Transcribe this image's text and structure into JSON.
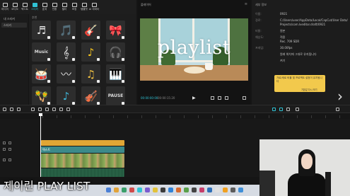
{
  "toolbar": {
    "tools": [
      {
        "label": "미디어",
        "active": false
      },
      {
        "label": "오디오",
        "active": false
      },
      {
        "label": "텍스트",
        "active": false
      },
      {
        "label": "스티커",
        "active": true
      },
      {
        "label": "효과",
        "active": false
      },
      {
        "label": "전환",
        "active": false
      },
      {
        "label": "필터",
        "active": false
      },
      {
        "label": "조정",
        "active": false
      },
      {
        "label": "템플릿",
        "active": false
      },
      {
        "label": "AI 아바타",
        "active": false
      }
    ]
  },
  "sidebar": {
    "items": [
      "내 스티커",
      "스티커",
      "",
      "",
      "",
      ""
    ]
  },
  "media": {
    "header": "추천",
    "stickers": [
      {
        "icon": "♬",
        "color": "#e8e8e8"
      },
      {
        "icon": "🎵",
        "color": "#e8e8e8"
      },
      {
        "icon": "🎸",
        "color": "#e59a2c"
      },
      {
        "icon": "🎀",
        "color": "#d6403a"
      },
      {
        "icon": "Music",
        "color": "#d9d9d9"
      },
      {
        "icon": "𝄞",
        "color": "#e8e8e8"
      },
      {
        "icon": "♪",
        "color": "#f5c31e"
      },
      {
        "icon": "🎧",
        "color": "#e8e8e8"
      },
      {
        "icon": "🥁",
        "color": "#d64f7a"
      },
      {
        "icon": "〰",
        "color": "#e8e8e8"
      },
      {
        "icon": "♫",
        "color": "#f0c040"
      },
      {
        "icon": "🎹",
        "color": "#e84e8a"
      },
      {
        "icon": "🪇",
        "color": "#e08a3a"
      },
      {
        "icon": "♪",
        "color": "#3fb6d8"
      },
      {
        "icon": "🎻",
        "color": "#d4a060"
      },
      {
        "icon": "PAUSE",
        "color": "#dcdcdc"
      }
    ]
  },
  "player": {
    "header": "플레이어",
    "video_title": "playlist",
    "timecode_current": "00:00:00:00",
    "timecode_total": "00:00:15:20"
  },
  "details": {
    "header": "세부 정보",
    "rows": [
      {
        "key": "이름:",
        "value": "0921"
      },
      {
        "key": "경로:",
        "value": "C:/Users/user/AppData/Local/CapCut/User Data/"
      },
      {
        "key": "",
        "value": "Projects/com.lveditor.draft/0921"
      },
      {
        "key": "비율:",
        "value": "원본"
      },
      {
        "key": "해상도:",
        "value": "적용"
      },
      {
        "key": "",
        "value": "Rec. 709 SDR"
      },
      {
        "key": "프레임:",
        "value": "30.00fps"
      },
      {
        "key": "",
        "value": "원래 위치에 그대로 유지됩니다"
      },
      {
        "key": "",
        "value": "켜기"
      }
    ],
    "tip_text": "가로/세로 비율 및 프로젝트 설정이 유지됩니다",
    "tip_button": "기본값 다시 보기"
  },
  "timeline": {
    "text_clip_label": "텍스트"
  },
  "caption": "제이린 PLAY LIST"
}
